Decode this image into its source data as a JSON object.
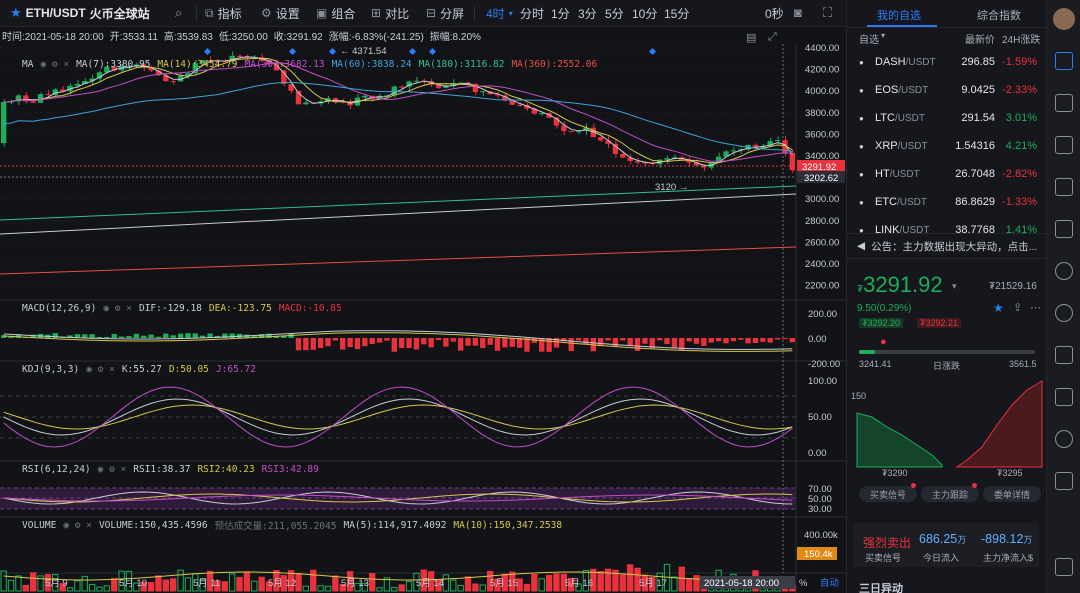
{
  "toolbar": {
    "symbol": "ETH/USDT",
    "exchange": "火币全球站",
    "indicators": "指标",
    "settings": "设置",
    "combo": "组合",
    "compare": "对比",
    "split": "分屏",
    "interval": "4时",
    "intervals": [
      "分时",
      "1分",
      "3分",
      "5分",
      "10分",
      "15分"
    ],
    "zero": "0秒"
  },
  "info": {
    "time": "时间:2021-05-18 20:00",
    "open": "开:3533.11",
    "high": "高:3539.83",
    "low": "低:3250.00",
    "close": "收:3291.92",
    "change": "涨幅:-6.83%(-241.25)",
    "amplitude": "振幅:8.20%"
  },
  "ma_row": {
    "name": "MA",
    "ma7": "MA(7):3380.95",
    "ma14": "MA(14):3454.79",
    "ma30": "MA(30):3682.13",
    "ma60": "MA(60):3838.24",
    "ma180": "MA(180):3116.82",
    "ma360": "MA(360):2552.06"
  },
  "macd_row": {
    "name": "MACD(12,26,9)",
    "dif": "DIF:-129.18",
    "dea": "DEA:-123.75",
    "macd": "MACD:-10.85"
  },
  "kdj_row": {
    "name": "KDJ(9,3,3)",
    "k": "K:55.27",
    "d": "D:50.05",
    "j": "J:65.72"
  },
  "rsi_row": {
    "name": "RSI(6,12,24)",
    "rsi1": "RSI1:38.37",
    "rsi2": "RSI2:40.23",
    "rsi3": "RSI3:42.89"
  },
  "vol_row": {
    "name": "VOLUME",
    "volume": "VOLUME:150,435.4596",
    "estimate": "预估成交量:211,055.2045",
    "ma5": "MA(5):114,917.4092",
    "ma10": "MA(10):150,347.2538"
  },
  "chart": {
    "price_axis": [
      "4400.00",
      "4200.00",
      "4000.00",
      "3800.00",
      "3600.00",
      "3400.00",
      "3200.00",
      "3000.00",
      "2800.00",
      "2600.00",
      "2400.00",
      "2200.00"
    ],
    "price_tags": {
      "current": "3291.92",
      "cross": "3202.62",
      "cross_red": "3291.92"
    },
    "macd_axis": [
      "200.00",
      "0.00",
      "-200.00"
    ],
    "kdj_axis": [
      "100.00",
      "50.00",
      "0.00"
    ],
    "rsi_axis": [
      "70.00",
      "50.00",
      "30.00"
    ],
    "vol_axis": [
      "400.00k"
    ],
    "vol_tag": "150.4k",
    "high_label": "← 4371.54",
    "low_label": "3120 →",
    "dates": [
      "5月 9",
      "5月 10",
      "5月 11",
      "5月 12",
      "5月 13",
      "5月 14",
      "5月 15",
      "5月 16",
      "5月 17"
    ],
    "cross_date": "2021-05-18 20:00",
    "percent": "%",
    "auto": "自动"
  },
  "right": {
    "tabs": [
      "我的自选",
      "综合指数"
    ],
    "header": {
      "select": "自选",
      "last": "最新价",
      "change": "24H涨跌"
    },
    "watch": [
      {
        "base": "DASH",
        "quote": "/USDT",
        "price": "296.85",
        "change": "-1.59%",
        "up": false
      },
      {
        "base": "EOS",
        "quote": "/USDT",
        "price": "9.0425",
        "change": "-2.33%",
        "up": false
      },
      {
        "base": "LTC",
        "quote": "/USDT",
        "price": "291.54",
        "change": "3.01%",
        "up": true
      },
      {
        "base": "XRP",
        "quote": "/USDT",
        "price": "1.54316",
        "change": "4.21%",
        "up": true
      },
      {
        "base": "HT",
        "quote": "/USDT",
        "price": "26.7048",
        "change": "-2.82%",
        "up": false
      },
      {
        "base": "ETC",
        "quote": "/USDT",
        "price": "86.8629",
        "change": "-1.33%",
        "up": false
      },
      {
        "base": "LINK",
        "quote": "/USDT",
        "price": "38.7768",
        "change": "1.41%",
        "up": true
      }
    ],
    "notice": "公告：主力数据出现大异动，点击...",
    "price_prefix": "₮",
    "price": "3291.92",
    "cny_prefix": "₮",
    "cny": "21529.16",
    "delta": "9.50(0.29%)",
    "bid": "₮3292.20",
    "ask": "₮3292.21",
    "range_low": "3241.41",
    "range_label": "日涨跌",
    "range_high": "3561.5",
    "depth_y": "150",
    "depth_left": "₮3290",
    "depth_right": "₮3295",
    "tags": [
      "买卖信号",
      "主力跟踪",
      "委单详情"
    ],
    "signal": "强烈卖出",
    "signal_sub": "买卖信号",
    "inflow": "686.25",
    "inflow_unit": "万",
    "inflow_label": "今日流入",
    "net": "-898.12",
    "net_unit": "万",
    "net_label": "主力净流入$",
    "bottom": "三日异动"
  },
  "colors": {
    "up": "#1cae5a",
    "down": "#e8323c",
    "accent": "#2f7cf6"
  }
}
